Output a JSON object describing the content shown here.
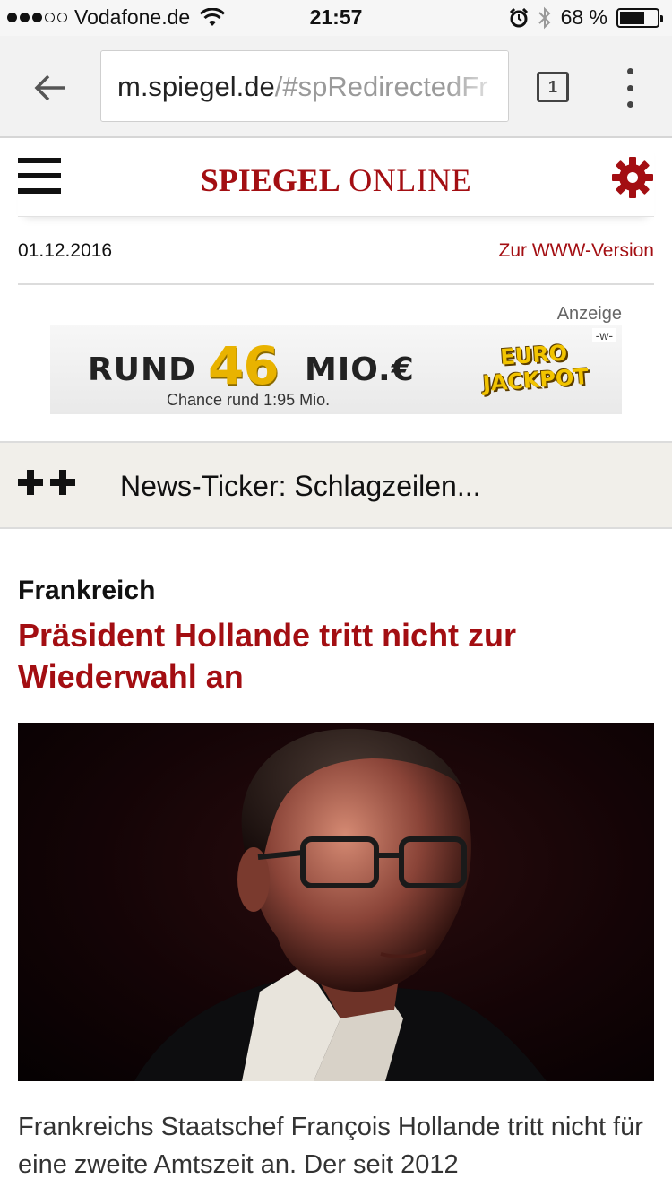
{
  "status_bar": {
    "carrier": "Vodafone.de",
    "time": "21:57",
    "battery_percent": "68 %",
    "battery_level": 0.68
  },
  "browser": {
    "url_host": "m.spiegel.de",
    "url_rest": "/#spRedirectedFr",
    "tab_count": "1"
  },
  "site": {
    "logo_part1": "SPIEGEL",
    "logo_part2": "ONLINE",
    "accent_color": "#a30e12"
  },
  "date_row": {
    "date": "01.12.2016",
    "www_link": "Zur WWW-Version"
  },
  "ad": {
    "label": "Anzeige",
    "w_tag": "-w-",
    "word1": "RUND",
    "number": "46",
    "word2": "MIO.€",
    "chance": "Chance rund 1:95 Mio.",
    "logo_line1": "EURO",
    "logo_line2": "JACKPOT"
  },
  "ticker": {
    "text": "News-Ticker: Schlagzeilen..."
  },
  "article": {
    "kicker": "Frankreich",
    "headline": "Präsident Hollande tritt nicht zur Wiederwahl an",
    "teaser": "Frankreichs Staatschef François Hollande tritt nicht für eine zweite Amtszeit an. Der seit 2012"
  }
}
